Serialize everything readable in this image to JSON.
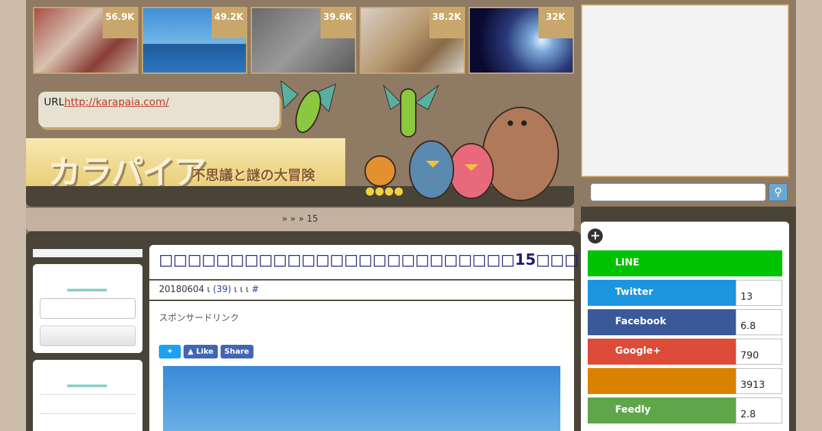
{
  "thumbs": [
    {
      "count": "56.9K"
    },
    {
      "count": "49.2K"
    },
    {
      "count": "39.6K"
    },
    {
      "count": "38.2K"
    },
    {
      "count": "32K"
    }
  ],
  "url_box": {
    "label": "URL",
    "link": "http://karapaia.com/"
  },
  "logo": {
    "brand": "カラパイア",
    "tagline": "不思議と謎の大冒険"
  },
  "breadcrumb": "»   »         » 15",
  "article": {
    "title": "□□□□□□□□□□□□□□□□□□□□□□□□□15□□□",
    "meta_date": "20180604 ι",
    "meta_comments": "(39)",
    "meta_rest": " ι  ι          ι",
    "meta_hash": "#",
    "sponsor": "スポンサードリンク",
    "share_like": "Like",
    "share_share": "Share"
  },
  "social": [
    {
      "name": "LINE",
      "count": "",
      "color": "#00c300"
    },
    {
      "name": "Twitter",
      "count": "13",
      "color": "#1b95e0"
    },
    {
      "name": "Facebook",
      "count": "6.8",
      "color": "#3b5998"
    },
    {
      "name": "Google+",
      "count": "790",
      "color": "#dd4b39"
    },
    {
      "name": "",
      "count": "3913",
      "color": "#d98200"
    },
    {
      "name": "Feedly",
      "count": "2.8",
      "color": "#5fa64a"
    }
  ]
}
